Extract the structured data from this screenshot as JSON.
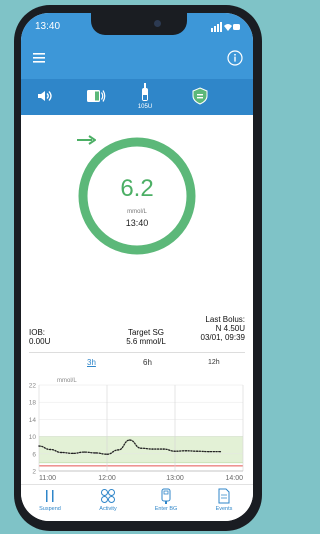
{
  "status": {
    "time": "13:40"
  },
  "iconbar": {
    "reservoir_units": "105U"
  },
  "sg": {
    "value": "6.2",
    "unit": "mmol/L",
    "time": "13:40",
    "trend": "arrow-right-icon"
  },
  "info": {
    "iob_label": "IOB:",
    "iob_value": "0.00U",
    "target_label": "Target SG",
    "target_value": "5.6 mmol/L",
    "bolus_label": "Last Bolus:",
    "bolus_value": "N 4.50U",
    "bolus_time": "03/01, 09:39"
  },
  "tabs": [
    "3h",
    "6h",
    "12h"
  ],
  "chart_data": {
    "type": "line",
    "ylabel": "mmol/L",
    "ylim": [
      2,
      22
    ],
    "yticks": [
      22,
      18,
      14,
      10,
      6,
      2
    ],
    "x": [
      "11:00",
      "11:10",
      "11:20",
      "11:30",
      "11:40",
      "11:50",
      "12:00",
      "12:10",
      "12:20",
      "12:30",
      "12:40",
      "12:50",
      "13:00",
      "13:10",
      "13:20",
      "13:30",
      "13:40"
    ],
    "xticks": [
      "11:00",
      "12:00",
      "13:00",
      "14:00"
    ],
    "series": [
      {
        "values": [
          7.8,
          7.0,
          6.3,
          6.1,
          6.4,
          6.2,
          5.9,
          6.9,
          9.2,
          7.3,
          7.1,
          7.1,
          6.6,
          6.7,
          6.6,
          6.5,
          6.5
        ]
      }
    ],
    "target_range": [
      3.9,
      10.0
    ],
    "low_limit": 3.2
  },
  "nav": [
    {
      "label": "Suspend",
      "icon": "pause-icon"
    },
    {
      "label": "Activity",
      "icon": "activity-icon"
    },
    {
      "label": "Enter BG",
      "icon": "meter-icon"
    },
    {
      "label": "Events",
      "icon": "events-icon"
    }
  ],
  "colors": {
    "header": "#3d97d8",
    "iconbar": "#2f86c9",
    "ring": "#5cb879",
    "sg": "#4caf65"
  }
}
